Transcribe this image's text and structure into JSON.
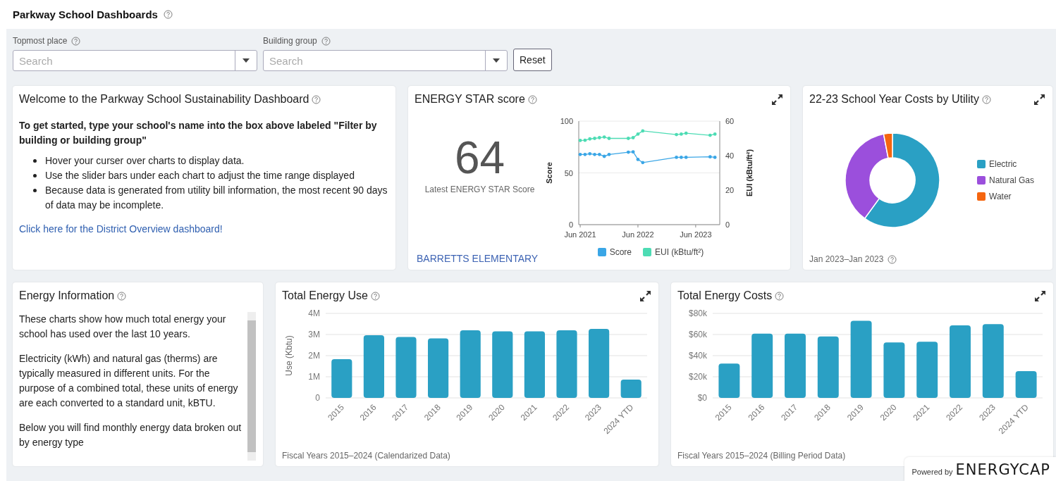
{
  "header": {
    "title": "Parkway School Dashboards"
  },
  "filters": [
    {
      "label": "Topmost place",
      "placeholder": "Search"
    },
    {
      "label": "Building group",
      "placeholder": "Search"
    }
  ],
  "reset_button": "Reset",
  "welcome": {
    "title": "Welcome to the Parkway School Sustainability Dashboard",
    "intro": "To get started, type your school's name into the box above labeled \"Filter by building or building group\"",
    "bullets": [
      "Hover your curser over charts to display data.",
      "Use the slider bars under each chart to adjust the time range displayed",
      "Because data is generated from utility bill information, the most recent 90 days of data may be incomplete."
    ],
    "link": "Click here for the District Overview dashboard!"
  },
  "energy_star": {
    "title": "ENERGY STAR score",
    "score": "64",
    "score_label": "Latest ENERGY STAR Score",
    "building": "BARRETTS ELEMENTARY",
    "chart_data": {
      "type": "line",
      "ylabel": "Score",
      "y2label": "EUI (kBtu/ft²)",
      "ylim": [
        0,
        100
      ],
      "yticks": [
        0,
        50,
        100
      ],
      "y2lim": [
        0,
        60
      ],
      "y2ticks": [
        0,
        20,
        40,
        60
      ],
      "grid": true,
      "legend": "bottom",
      "categories": [
        "Jun 2021",
        null,
        null,
        null,
        null,
        null,
        null,
        null,
        null,
        null,
        null,
        null,
        "Jun 2022",
        null,
        null,
        null,
        null,
        null,
        null,
        null,
        null,
        null,
        null,
        null,
        "Jun 2023",
        null,
        null,
        null,
        null
      ],
      "series": [
        {
          "name": "Score",
          "color": "#3aa6e6",
          "values": [
            67.8,
            67.8,
            68.5,
            67.8,
            67.8,
            66,
            67.8,
            null,
            null,
            null,
            70,
            70.3,
            63,
            60,
            null,
            null,
            null,
            null,
            null,
            null,
            65,
            65,
            65,
            null,
            null,
            null,
            null,
            65.5,
            65
          ]
        },
        {
          "name": "EUI (kBtu/ft²)",
          "color": "#4ddcb4",
          "axis": "y2",
          "values": [
            48.8,
            48.9,
            49.7,
            50,
            50.4,
            50.8,
            50,
            null,
            null,
            null,
            50,
            50.4,
            52.5,
            54.3,
            null,
            null,
            null,
            null,
            null,
            null,
            52.2,
            52.5,
            53,
            null,
            null,
            null,
            null,
            51.8,
            52.5
          ]
        }
      ]
    }
  },
  "costs_by_utility": {
    "title": "22-23 School Year Costs by Utility",
    "legend": [
      {
        "label": "Electric",
        "color": "#2aa0c4"
      },
      {
        "label": "Natural Gas",
        "color": "#9b4fdc"
      },
      {
        "label": "Water",
        "color": "#f5650f"
      }
    ],
    "footer": "Jan 2023–Jan 2023"
  },
  "energy_info": {
    "title": "Energy Information",
    "paragraphs": [
      "These charts show how much total energy your school has used over the last 10 years.",
      "Electricity (kWh) and natural gas (therms) are typically measured in different units. For the purpose of a combined total, these units of energy are each converted to a standard unit, kBTU.",
      "Below you will find monthly energy data broken out by energy type"
    ]
  },
  "total_energy_use": {
    "title": "Total Energy Use",
    "footer": "Fiscal Years 2015–2024 (Calendarized Data)",
    "chart_data": {
      "type": "bar",
      "ylabel": "Use (Kbtu)",
      "ylim": [
        0,
        4000000
      ],
      "yticks": [
        {
          "value": 0,
          "label": "0"
        },
        {
          "value": 1000000,
          "label": "1M"
        },
        {
          "value": 2000000,
          "label": "2M"
        },
        {
          "value": 3000000,
          "label": "3M"
        },
        {
          "value": 4000000,
          "label": "4M"
        }
      ],
      "categories": [
        "2015",
        "2016",
        "2017",
        "2018",
        "2019",
        "2020",
        "2021",
        "2022",
        "2023",
        "2024 YTD"
      ],
      "grid": true,
      "series": [
        {
          "color": "#2aa0c4",
          "values": [
            1830000,
            2970000,
            2880000,
            2820000,
            3200000,
            3150000,
            3150000,
            3200000,
            3270000,
            870000
          ]
        }
      ]
    }
  },
  "total_energy_costs": {
    "title": "Total Energy Costs",
    "footer": "Fiscal Years 2015–2024 (Billing Period Data)",
    "chart_data": {
      "type": "bar",
      "ylim": [
        0,
        80000
      ],
      "yticks": [
        {
          "value": 0,
          "label": "$0"
        },
        {
          "value": 20000,
          "label": "$20k"
        },
        {
          "value": 40000,
          "label": "$40k"
        },
        {
          "value": 60000,
          "label": "$60k"
        },
        {
          "value": 80000,
          "label": "$80k"
        }
      ],
      "categories": [
        "2015",
        "2016",
        "2017",
        "2018",
        "2019",
        "2020",
        "2021",
        "2022",
        "2023",
        "2024 YTD"
      ],
      "grid": true,
      "series": [
        {
          "color": "#2aa0c4",
          "values": [
            32500,
            60800,
            60800,
            58200,
            73000,
            52500,
            53200,
            68700,
            69800,
            25300
          ]
        }
      ]
    }
  },
  "badge": {
    "prefix": "Powered by",
    "brand": "ENERGYCAP"
  }
}
